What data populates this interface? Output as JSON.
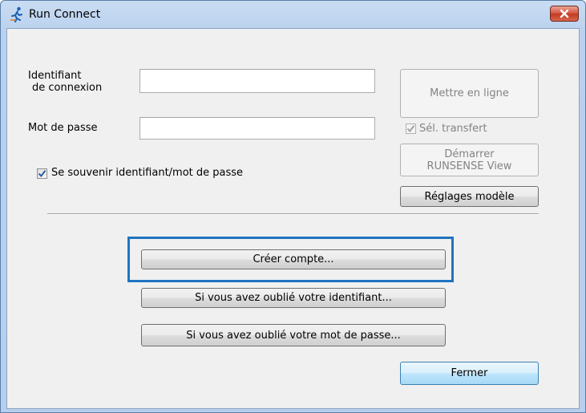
{
  "window": {
    "title": "Run Connect",
    "close_icon": "close-icon"
  },
  "form": {
    "login_label_line1": "Identifiant",
    "login_label_line2": "de connexion",
    "login_value": "",
    "password_label": "Mot de passe",
    "password_value": "",
    "remember_label": "Se souvenir identifiant/mot de passe",
    "remember_checked": true
  },
  "side_panel": {
    "upload_button": "Mettre en ligne",
    "select_transfer_label": "Sél. transfert",
    "select_transfer_checked": true,
    "start_view_line1": "Démarrer",
    "start_view_line2": "RUNSENSE View",
    "model_settings_button": "Réglages modèle"
  },
  "actions": {
    "create_account": "Créer compte...",
    "forgot_id": "Si vous avez oublié votre identifiant...",
    "forgot_password": "Si vous avez oublié votre mot de passe...",
    "close": "Fermer"
  },
  "colors": {
    "highlight": "#1f74c0",
    "titlebar": "#b9d1ee",
    "close_button": "#c23a22"
  }
}
